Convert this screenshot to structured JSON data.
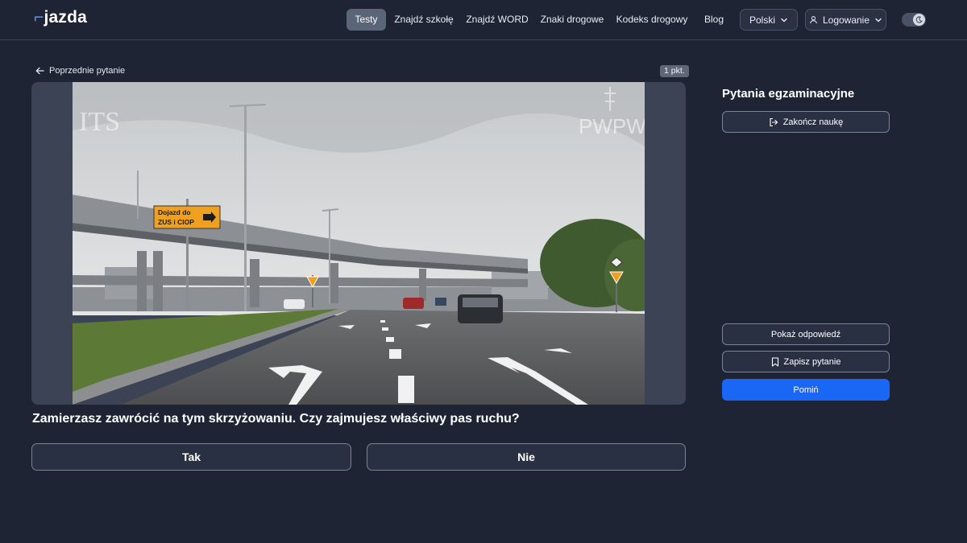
{
  "header": {
    "logo": "jazda",
    "nav": [
      {
        "label": "Testy",
        "active": true
      },
      {
        "label": "Znajdź szkołę",
        "active": false
      },
      {
        "label": "Znajdź WORD",
        "active": false
      },
      {
        "label": "Znaki drogowe",
        "active": false
      },
      {
        "label": "Kodeks drogowy",
        "active": false
      },
      {
        "label": "Blog",
        "active": false
      }
    ],
    "language": "Polski",
    "login": "Logowanie",
    "theme_toggle_icon": "moon-icon"
  },
  "question": {
    "prev_label": "Poprzednie pytanie",
    "points": "1 pkt.",
    "text": "Zamierzasz zawrócić na tym skrzyżowaniu. Czy zajmujesz właściwy pas ruchu?",
    "answers": [
      "Tak",
      "Nie"
    ],
    "media": {
      "sign_line1": "Dojazd do",
      "sign_line2": "ZUS i CIOP",
      "watermark_left": "ITS",
      "watermark_right": "PWPW"
    }
  },
  "sidebar": {
    "title": "Pytania egzaminacyjne",
    "end_label": "Zakończ naukę",
    "show_answer_label": "Pokaż odpowiedź",
    "save_label": "Zapisz pytanie",
    "skip_label": "Pomiń"
  },
  "colors": {
    "background": "#1e2434",
    "accent": "#1a66f5",
    "nav_active": "#5b6578"
  }
}
